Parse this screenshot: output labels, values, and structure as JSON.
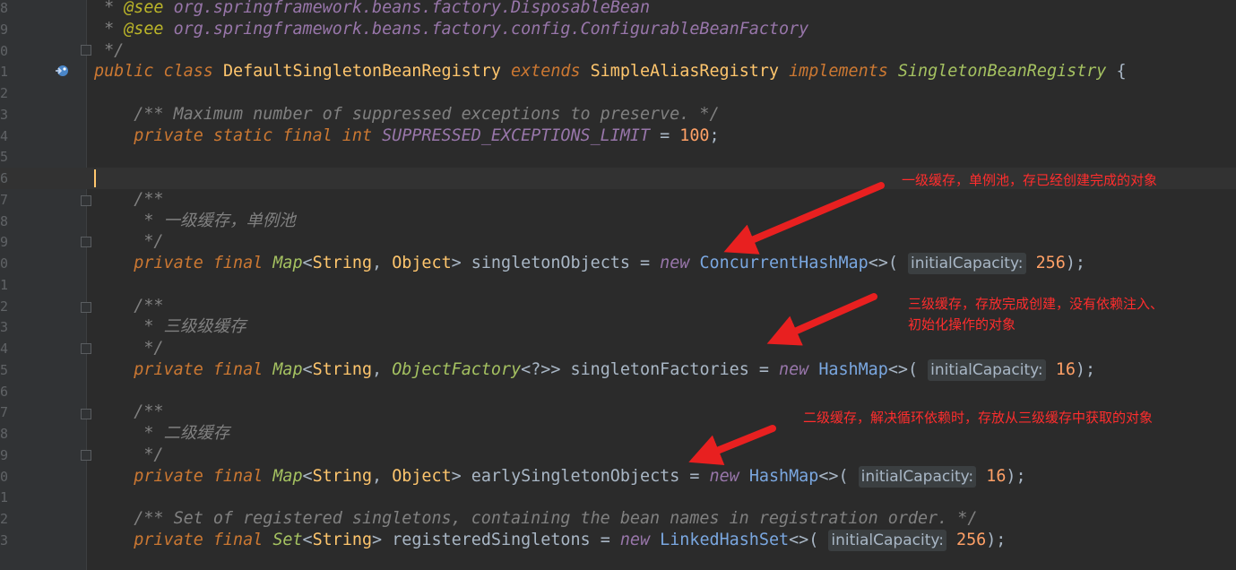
{
  "editor": {
    "lines": [
      {
        "num": "8",
        "tokens": [
          {
            "cls": "cmg",
            "text": " * "
          },
          {
            "cls": "at",
            "text": "@see "
          },
          {
            "cls": "tagtxt",
            "text": "org.springframework.beans.factory.DisposableBean"
          }
        ]
      },
      {
        "num": "9",
        "tokens": [
          {
            "cls": "cmg",
            "text": " * "
          },
          {
            "cls": "at",
            "text": "@see "
          },
          {
            "cls": "tagtxt",
            "text": "org.springframework.beans.factory.config.ConfigurableBeanFactory"
          }
        ]
      },
      {
        "num": "0",
        "tokens": [
          {
            "cls": "cmg",
            "text": " */"
          }
        ]
      },
      {
        "num": "1",
        "tokens": [
          {
            "cls": "kw",
            "text": "public class "
          },
          {
            "cls": "cls2",
            "text": "DefaultSingletonBeanRegistry "
          },
          {
            "cls": "kw",
            "text": "extends "
          },
          {
            "cls": "cls2",
            "text": "SimpleAliasRegistry "
          },
          {
            "cls": "kw",
            "text": "implements "
          },
          {
            "cls": "type",
            "text": "SingletonBeanRegistry "
          },
          {
            "cls": "plain",
            "text": "{"
          }
        ]
      },
      {
        "num": "2",
        "tokens": []
      },
      {
        "num": "3",
        "tokens": [
          {
            "cls": "cmg",
            "text": "    /** Maximum number of suppressed exceptions to preserve. */"
          }
        ]
      },
      {
        "num": "4",
        "tokens": [
          {
            "cls": "kw",
            "text": "    private static final int "
          },
          {
            "cls": "const",
            "text": "SUPPRESSED_EXCEPTIONS_LIMIT "
          },
          {
            "cls": "plain",
            "text": "= "
          },
          {
            "cls": "num2",
            "text": "100"
          },
          {
            "cls": "plain",
            "text": ";"
          }
        ]
      },
      {
        "num": "5",
        "tokens": []
      },
      {
        "num": "6",
        "tokens": []
      },
      {
        "num": "7",
        "tokens": [
          {
            "cls": "cmg",
            "text": "    /**"
          }
        ]
      },
      {
        "num": "8",
        "tokens": [
          {
            "cls": "cmg",
            "text": "     * "
          },
          {
            "cls": "cmcjk",
            "text": "一级缓存，单例池"
          }
        ]
      },
      {
        "num": "9",
        "tokens": [
          {
            "cls": "cmg",
            "text": "     */"
          }
        ]
      },
      {
        "num": "0",
        "tokens": [
          {
            "cls": "kw",
            "text": "    private final "
          },
          {
            "cls": "type",
            "text": "Map"
          },
          {
            "cls": "plain",
            "text": "<"
          },
          {
            "cls": "cls2",
            "text": "String"
          },
          {
            "cls": "plain",
            "text": ", "
          },
          {
            "cls": "cls2",
            "text": "Object"
          },
          {
            "cls": "plain",
            "text": "> singletonObjects = "
          },
          {
            "cls": "ext",
            "text": "new "
          },
          {
            "cls": "blue",
            "text": "ConcurrentHashMap"
          },
          {
            "cls": "plain",
            "text": "<>( "
          },
          {
            "cls": "hint",
            "text": "initialCapacity:"
          },
          {
            "cls": "plain",
            "text": " "
          },
          {
            "cls": "num2",
            "text": "256"
          },
          {
            "cls": "plain",
            "text": ");"
          }
        ]
      },
      {
        "num": "1",
        "tokens": []
      },
      {
        "num": "2",
        "tokens": [
          {
            "cls": "cmg",
            "text": "    /**"
          }
        ]
      },
      {
        "num": "3",
        "tokens": [
          {
            "cls": "cmg",
            "text": "     * "
          },
          {
            "cls": "cmcjk",
            "text": "三级级缓存"
          }
        ]
      },
      {
        "num": "4",
        "tokens": [
          {
            "cls": "cmg",
            "text": "     */"
          }
        ]
      },
      {
        "num": "5",
        "tokens": [
          {
            "cls": "kw",
            "text": "    private final "
          },
          {
            "cls": "type",
            "text": "Map"
          },
          {
            "cls": "plain",
            "text": "<"
          },
          {
            "cls": "cls2",
            "text": "String"
          },
          {
            "cls": "plain",
            "text": ", "
          },
          {
            "cls": "type",
            "text": "ObjectFactory"
          },
          {
            "cls": "plain",
            "text": "<?>> singletonFactories = "
          },
          {
            "cls": "ext",
            "text": "new "
          },
          {
            "cls": "blue",
            "text": "HashMap"
          },
          {
            "cls": "plain",
            "text": "<>( "
          },
          {
            "cls": "hint",
            "text": "initialCapacity:"
          },
          {
            "cls": "plain",
            "text": " "
          },
          {
            "cls": "num2",
            "text": "16"
          },
          {
            "cls": "plain",
            "text": ");"
          }
        ]
      },
      {
        "num": "6",
        "tokens": []
      },
      {
        "num": "7",
        "tokens": [
          {
            "cls": "cmg",
            "text": "    /**"
          }
        ]
      },
      {
        "num": "8",
        "tokens": [
          {
            "cls": "cmg",
            "text": "     * "
          },
          {
            "cls": "cmcjk",
            "text": "二级缓存"
          }
        ]
      },
      {
        "num": "9",
        "tokens": [
          {
            "cls": "cmg",
            "text": "     */"
          }
        ]
      },
      {
        "num": "0",
        "tokens": [
          {
            "cls": "kw",
            "text": "    private final "
          },
          {
            "cls": "type",
            "text": "Map"
          },
          {
            "cls": "plain",
            "text": "<"
          },
          {
            "cls": "cls2",
            "text": "String"
          },
          {
            "cls": "plain",
            "text": ", "
          },
          {
            "cls": "cls2",
            "text": "Object"
          },
          {
            "cls": "plain",
            "text": "> earlySingletonObjects = "
          },
          {
            "cls": "ext",
            "text": "new "
          },
          {
            "cls": "blue",
            "text": "HashMap"
          },
          {
            "cls": "plain",
            "text": "<>( "
          },
          {
            "cls": "hint",
            "text": "initialCapacity:"
          },
          {
            "cls": "plain",
            "text": " "
          },
          {
            "cls": "num2",
            "text": "16"
          },
          {
            "cls": "plain",
            "text": ");"
          }
        ]
      },
      {
        "num": "1",
        "tokens": []
      },
      {
        "num": "2",
        "tokens": [
          {
            "cls": "cmg",
            "text": "    /** Set of registered singletons, containing the bean names in registration order. */"
          }
        ]
      },
      {
        "num": "3",
        "tokens": [
          {
            "cls": "kw",
            "text": "    private final "
          },
          {
            "cls": "type",
            "text": "Set"
          },
          {
            "cls": "plain",
            "text": "<"
          },
          {
            "cls": "cls2",
            "text": "String"
          },
          {
            "cls": "plain",
            "text": "> registeredSingletons = "
          },
          {
            "cls": "ext",
            "text": "new "
          },
          {
            "cls": "blue",
            "text": "LinkedHashSet"
          },
          {
            "cls": "plain",
            "text": "<>( "
          },
          {
            "cls": "hint",
            "text": "initialCapacity:"
          },
          {
            "cls": "plain",
            "text": " "
          },
          {
            "cls": "num2",
            "text": "256"
          },
          {
            "cls": "plain",
            "text": ");"
          }
        ]
      }
    ]
  },
  "annotations": {
    "level1": "一级缓存，单例池，存已经创建完成的对象",
    "level3_line1": "三级缓存，存放完成创建，没有依赖注入、",
    "level3_line2": "初始化操作的对象",
    "level2": "二级缓存，解决循环依赖时，存放从三级缓存中获取的对象"
  },
  "colors": {
    "annotation": "#ff2d2d",
    "background": "#2b2b2b"
  },
  "icons": {
    "gutter_marker": "implements-interface-icon"
  }
}
